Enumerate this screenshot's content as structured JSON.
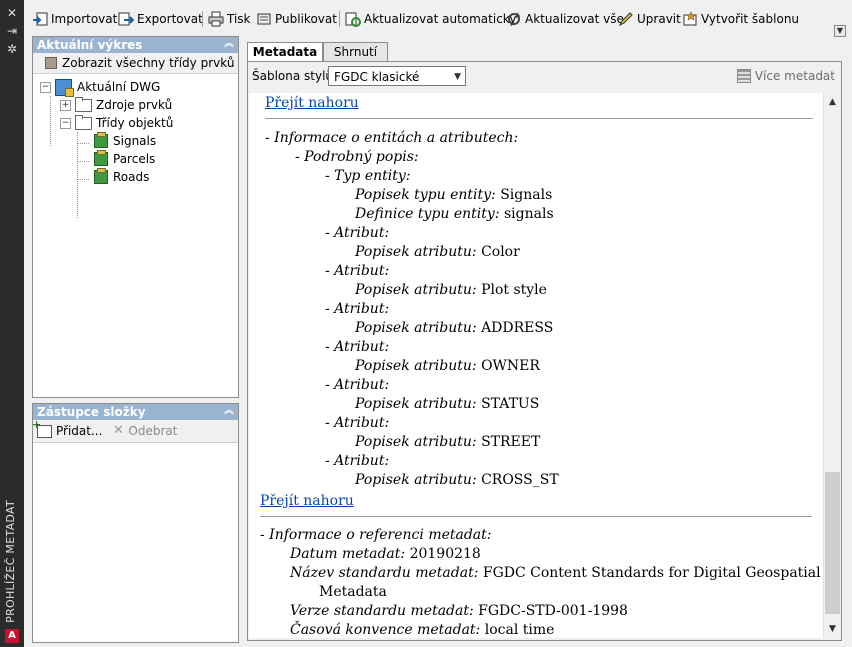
{
  "sidebar": {
    "title": "PROHLÍŽEČ METADAT",
    "icons": [
      "close-icon",
      "pin-icon",
      "settings-icon"
    ],
    "logo": "A"
  },
  "toolbar": {
    "import": "Importovat",
    "export": "Exportovat",
    "print": "Tisk",
    "publish": "Publikovat",
    "auto_update": "Aktualizovat automaticky",
    "update_all": "Aktualizovat vše",
    "edit": "Upravit",
    "create_template": "Vytvořit šablonu"
  },
  "current_drawing": {
    "header": "Aktuální výkres",
    "show_all": "Zobrazit všechny třídy prvků",
    "tree": {
      "root": "Aktuální DWG",
      "feature_sources": "Zdroje prvků",
      "object_classes": "Třídy objektů",
      "classes": [
        "Signals",
        "Parcels",
        "Roads"
      ]
    }
  },
  "folder_shortcuts": {
    "header": "Zástupce složky",
    "add": "Přidat...",
    "remove": "Odebrat"
  },
  "tabs": {
    "metadata": "Metadata",
    "summary": "Shrnutí"
  },
  "style": {
    "label": "Šablona stylů:",
    "value": "FGDC klasické",
    "more": "Více metadat"
  },
  "document": {
    "go_top": "Přejít nahoru",
    "entity_section": "- Informace o entitách a atributech:",
    "detailed": "- Podrobný popis:",
    "entity_type": "- Typ entity:",
    "entity_label": "Popisek typu entity:",
    "entity_label_value": "Signals",
    "entity_def": "Definice typu entity:",
    "entity_def_value": "signals",
    "attribute": "- Atribut:",
    "attr_label": "Popisek atributu:",
    "attributes": [
      "Color",
      "Plot style",
      "ADDRESS",
      "OWNER",
      "STATUS",
      "STREET",
      "CROSS_ST"
    ],
    "ref_section": "- Informace o referenci metadat:",
    "meta_date_label": "Datum metadat:",
    "meta_date": "20190218",
    "std_name_label": "Název standardu metadat:",
    "std_name_1": "FGDC Content Standards for Digital Geospatial",
    "std_name_2": "Metadata",
    "std_ver_label": "Verze standardu metadat:",
    "std_ver": "FGDC-STD-001-1998",
    "time_conv_label": "Časová konvence metadat:",
    "time_conv": "local time"
  }
}
